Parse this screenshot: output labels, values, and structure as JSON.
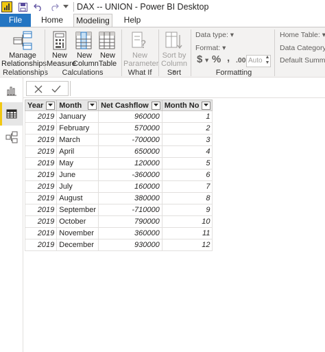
{
  "window": {
    "title": "DAX -- UNION - Power BI Desktop"
  },
  "tabs": {
    "file": "File",
    "home": "Home",
    "modeling": "Modeling",
    "help": "Help"
  },
  "ribbon": {
    "manage_relationships": [
      "Manage",
      "Relationships"
    ],
    "relationships_group": "Relationships",
    "new_measure": [
      "New",
      "Measure"
    ],
    "new_column": [
      "New",
      "Column"
    ],
    "new_table": [
      "New",
      "Table"
    ],
    "calculations_group": "Calculations",
    "new_parameter": [
      "New",
      "Parameter"
    ],
    "whatif_group": "What If",
    "sort_by_column": [
      "Sort by",
      "Column"
    ],
    "sort_group": "Sort",
    "data_type_label": "Data type:",
    "format_label": "Format:",
    "currency_symbol": "$",
    "percent_symbol": "%",
    "comma_symbol": ",",
    "decimal_symbol": ".00",
    "auto_value": "Auto",
    "formatting_group": "Formatting",
    "home_table_label": "Home Table:",
    "data_category_label": "Data Category: U",
    "default_summarization_label": "Default Summari"
  },
  "icons": {
    "sidebar": [
      "report-view-icon",
      "data-view-icon",
      "model-view-icon"
    ],
    "formula": [
      "cancel-icon",
      "commit-icon"
    ]
  },
  "colors": {
    "accent": "#f2c811",
    "file_tab": "#2475c2"
  },
  "table": {
    "columns": [
      "Year",
      "Month",
      "Net Cashflow",
      "Month No"
    ],
    "rows": [
      [
        "2019",
        "January",
        "960000",
        "1"
      ],
      [
        "2019",
        "February",
        "570000",
        "2"
      ],
      [
        "2019",
        "March",
        "-700000",
        "3"
      ],
      [
        "2019",
        "April",
        "650000",
        "4"
      ],
      [
        "2019",
        "May",
        "120000",
        "5"
      ],
      [
        "2019",
        "June",
        "-360000",
        "6"
      ],
      [
        "2019",
        "July",
        "160000",
        "7"
      ],
      [
        "2019",
        "August",
        "380000",
        "8"
      ],
      [
        "2019",
        "September",
        "-710000",
        "9"
      ],
      [
        "2019",
        "October",
        "790000",
        "10"
      ],
      [
        "2019",
        "November",
        "360000",
        "11"
      ],
      [
        "2019",
        "December",
        "930000",
        "12"
      ]
    ]
  }
}
